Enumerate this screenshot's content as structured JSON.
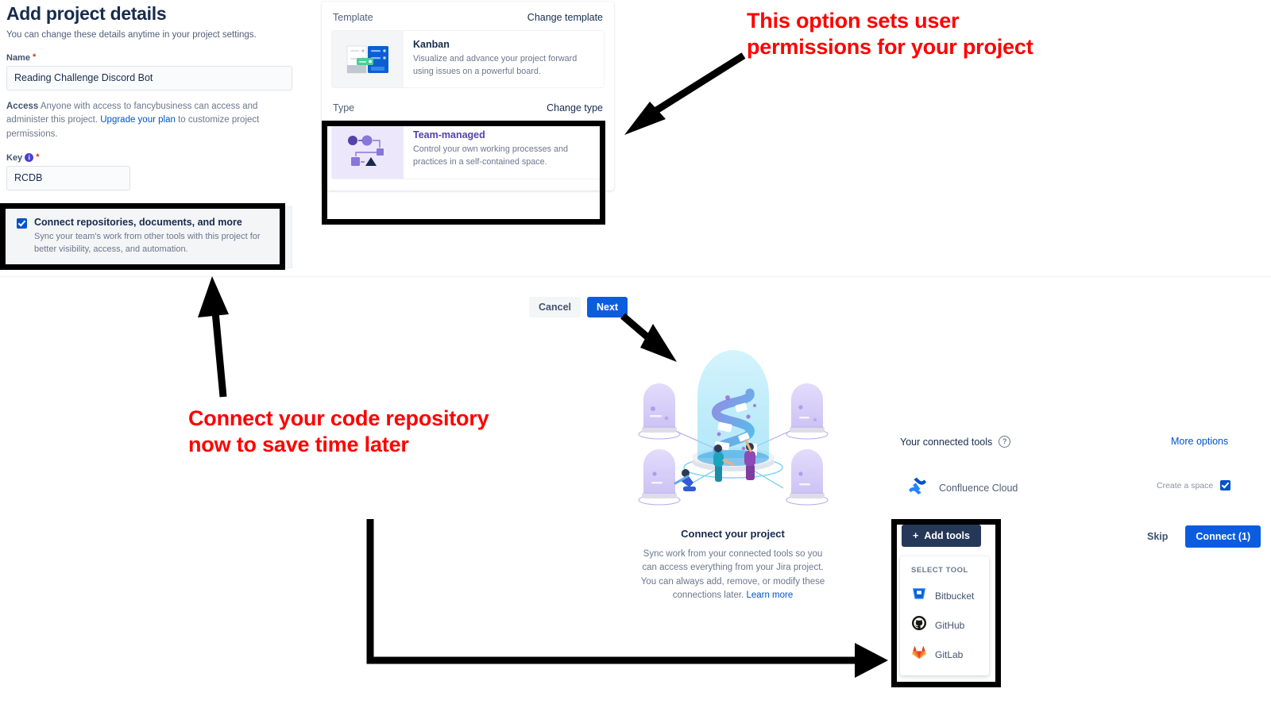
{
  "form": {
    "title": "Add project details",
    "subtitle": "You can change these details anytime in your project settings.",
    "name_label": "Name",
    "name_value": "Reading Challenge Discord Bot",
    "name_required_mark": "*",
    "access_label": "Access",
    "access_text_1": "Anyone with access to fancybusiness can access and administer this project. ",
    "access_link": "Upgrade your plan",
    "access_text_2": " to customize project permissions.",
    "key_label": "Key",
    "key_info_icon": "info-icon",
    "key_required_mark": "*",
    "key_value": "RCDB",
    "connect_checkbox": {
      "checked": true,
      "title": "Connect repositories, documents, and more",
      "description": "Sync your team's work from other tools with this project for better visibility, access, and automation."
    }
  },
  "summary": {
    "template_section_label": "Template",
    "change_template_link": "Change template",
    "template_card": {
      "title": "Kanban",
      "description": "Visualize and advance your project forward using issues on a powerful board.",
      "thumb_icon": "kanban-board-icon"
    },
    "type_section_label": "Type",
    "change_type_link": "Change type",
    "type_card": {
      "title": "Team-managed",
      "description": "Control your own working processes and practices in a self-contained space.",
      "thumb_icon": "workflow-nodes-icon"
    }
  },
  "footer": {
    "cancel_label": "Cancel",
    "next_label": "Next"
  },
  "connect_panel": {
    "illustration_name": "connect-tools-illustration",
    "title": "Connect your project",
    "body": "Sync work from your connected tools so you can access everything from your Jira project. You can always add, remove, or modify these connections later. ",
    "learn_more": "Learn more"
  },
  "tools_panel": {
    "heading": "Your connected tools",
    "help_icon": "question-mark-icon",
    "more_options": "More options",
    "connected": [
      {
        "name": "Confluence Cloud",
        "icon": "confluence-icon",
        "option_label": "Create a space",
        "option_checked": true
      }
    ],
    "add_tools_label": "Add tools",
    "add_tools_icon": "plus-icon",
    "menu_heading": "SELECT TOOL",
    "menu_items": [
      {
        "label": "Bitbucket",
        "icon": "bitbucket-icon"
      },
      {
        "label": "GitHub",
        "icon": "github-icon"
      },
      {
        "label": "GitLab",
        "icon": "gitlab-icon"
      }
    ],
    "skip_label": "Skip",
    "connect_label": "Connect (1)"
  },
  "annotations": {
    "color": "#ff0000",
    "callout_permissions": "This option sets user permissions for your project",
    "callout_repository": "Connect your code repository now to save time later"
  },
  "colors": {
    "brand_blue": "#0052cc",
    "primary_button": "#0c5ce0",
    "dark_button": "#253858",
    "text": "#172b4d",
    "muted": "#6b778c",
    "annotation_red": "#ff0000",
    "annotation_black": "#000000",
    "purple": "#5243aa"
  }
}
